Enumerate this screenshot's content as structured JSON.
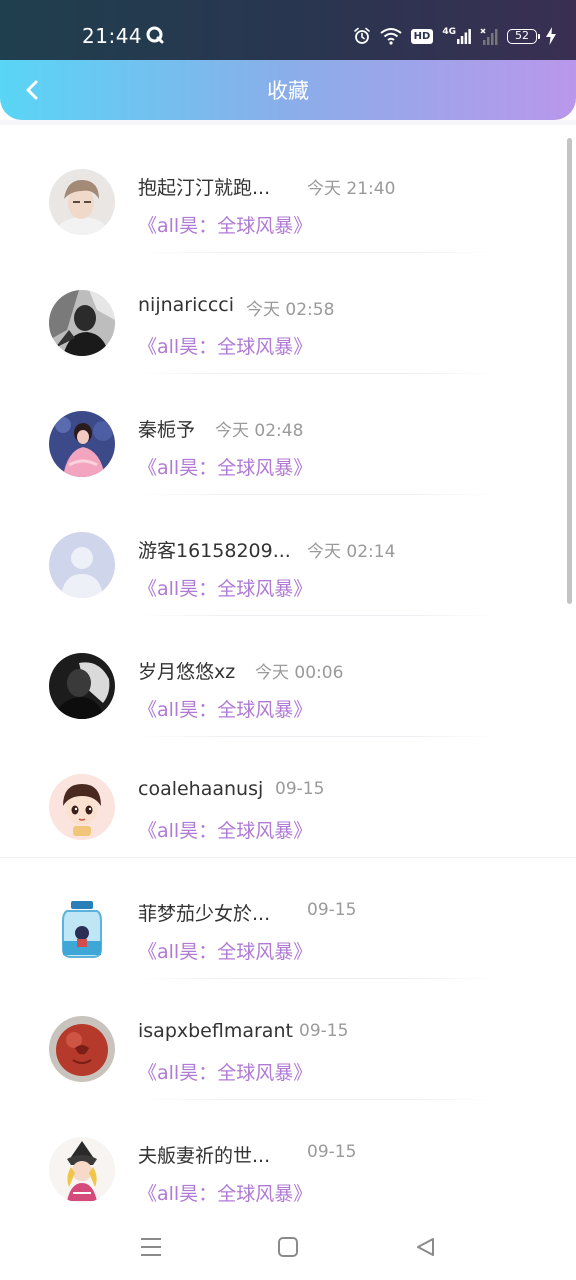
{
  "status_bar": {
    "time": "21:44",
    "hd_label": "HD",
    "network_label": "4G",
    "battery_level": "52"
  },
  "nav": {
    "title": "收藏"
  },
  "list": {
    "items": [
      {
        "name": "抱起汀汀就跑...",
        "time": "今天 21:40",
        "book": "《all昊：全球风暴》",
        "avatar": "avatar-photo-boy"
      },
      {
        "name": "nijnariccci",
        "time": "今天 02:58",
        "book": "《all昊：全球风暴》",
        "avatar": "avatar-photo-bw"
      },
      {
        "name": "秦栀予",
        "time": "今天 02:48",
        "book": "《all昊：全球风暴》",
        "avatar": "avatar-photo-girl-pink"
      },
      {
        "name": "游客16158209...",
        "time": "今天 02:14",
        "book": "《all昊：全球风暴》",
        "avatar": "avatar-default"
      },
      {
        "name": "岁月悠悠xz",
        "time": "今天 00:06",
        "book": "《all昊：全球风暴》",
        "avatar": "avatar-photo-dark"
      },
      {
        "name": "coalehaanusj",
        "time": "09-15",
        "book": "《all昊：全球风暴》",
        "avatar": "avatar-cartoon-boy"
      },
      {
        "name": "菲梦茄少女於...",
        "time": "09-15",
        "book": "《all昊：全球风暴》",
        "avatar": "avatar-jar"
      },
      {
        "name": "isapxbeflmarant",
        "time": "09-15",
        "book": "《all昊：全球风暴》",
        "avatar": "avatar-red-ball"
      },
      {
        "name": "夫舨妻祈的世...",
        "time": "09-15",
        "book": "《all昊：全球风暴》",
        "avatar": "avatar-anime-girl"
      }
    ]
  },
  "colors": {
    "accent_purple": "#b07ad6",
    "nav_gradient_start": "#59d5f5",
    "nav_gradient_end": "#b997ea"
  }
}
